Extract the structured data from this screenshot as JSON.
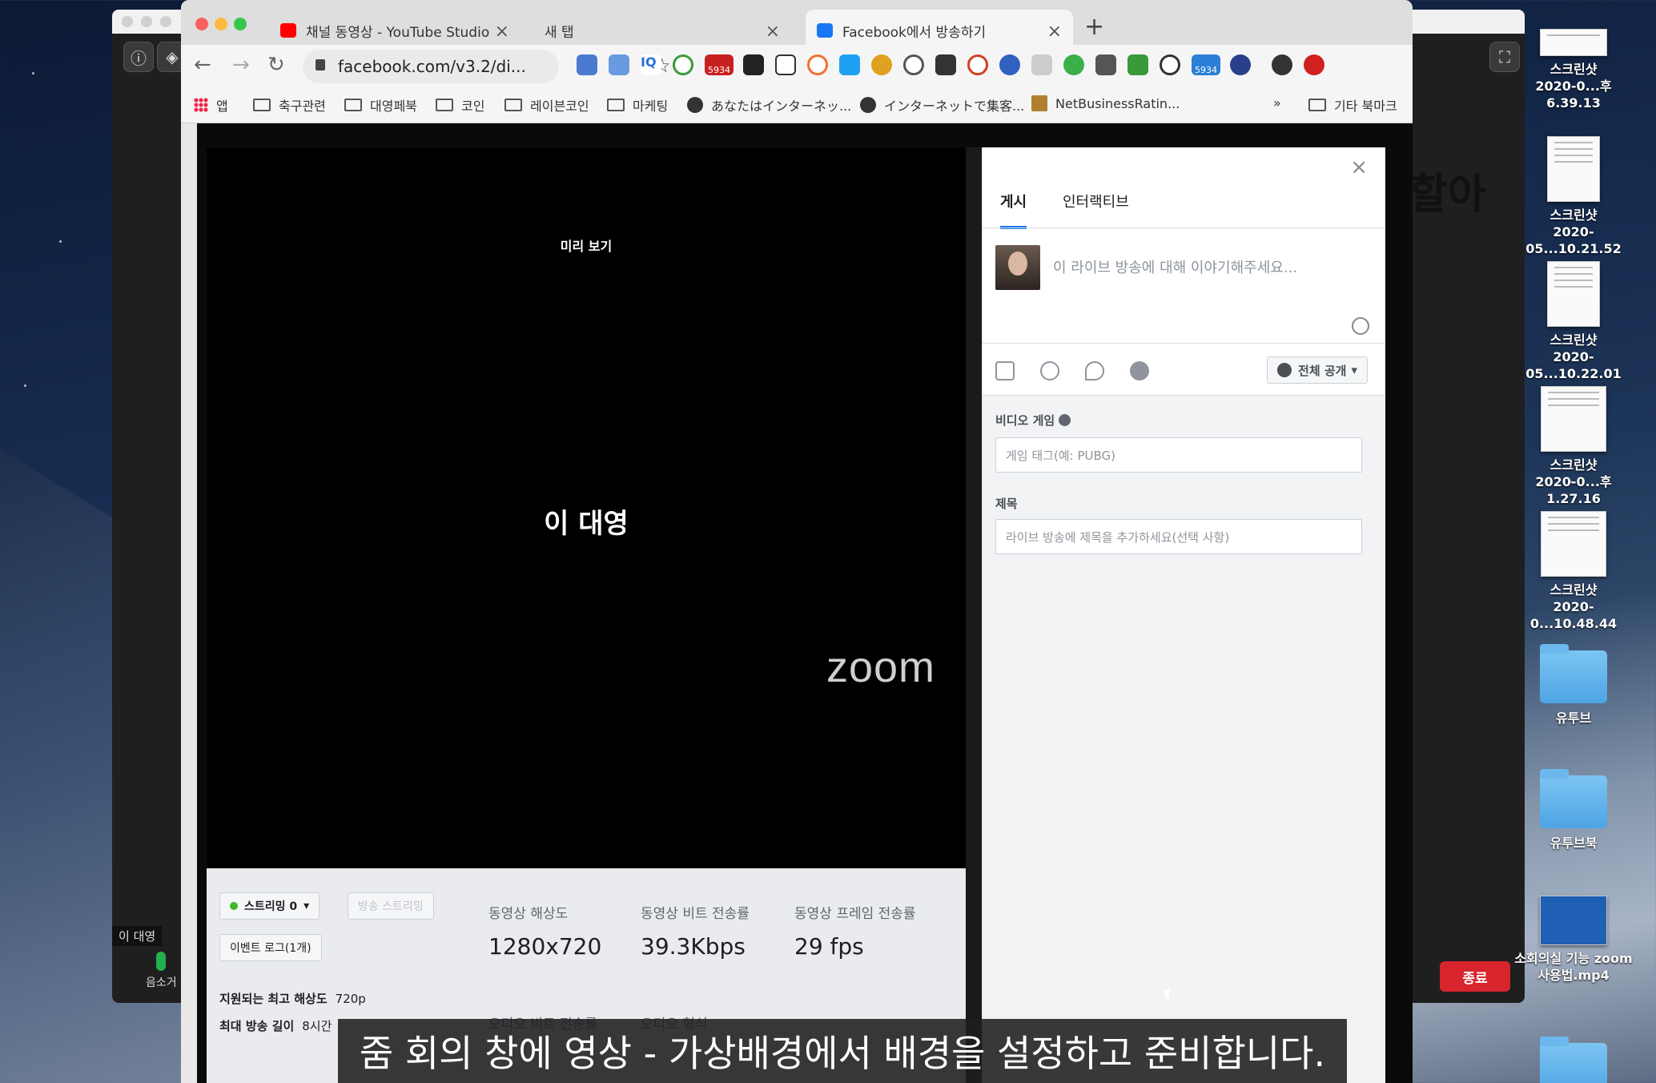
{
  "zoom": {
    "participant_name": "이 대영",
    "mic_label": "음소거",
    "end_label": "종료",
    "big_text": "할아"
  },
  "browser": {
    "tabs": [
      {
        "label": "채널 동영상 - YouTube Studio"
      },
      {
        "label": "새 탭"
      },
      {
        "label": "Facebook에서 방송하기"
      }
    ],
    "url": "facebook.com/v3.2/di...",
    "ext_badge": "5934",
    "bookmarks": [
      "앱",
      "축구관련",
      "대영페북",
      "코인",
      "레이븐코인",
      "마케팅",
      "あなたはインターネッ...",
      "インターネットで集客...",
      "NetBusinessRatin...",
      "»",
      "기타 북마크"
    ]
  },
  "preview": {
    "label": "미리 보기",
    "name": "이 대영",
    "logo": "zoom"
  },
  "stats": {
    "stream_label": "스트리밍 0",
    "stream_btn": "방송 스트리밍",
    "event_log": "이벤트 로그(1개)",
    "items": [
      {
        "label": "동영상 해상도",
        "value": "1280x720"
      },
      {
        "label": "동영상 비트 전송률",
        "value": "39.3Kbps"
      },
      {
        "label": "동영상 프레임 전송률",
        "value": "29 fps"
      }
    ],
    "audio": [
      {
        "label": "오디오 비트 전송률"
      },
      {
        "label": "오디오 형식"
      }
    ],
    "max_res_label": "지원되는 최고 해상도",
    "max_res": "720p",
    "max_len_label": "최대 방송 길이",
    "max_len": "8시간"
  },
  "composer": {
    "tabs": [
      "게시",
      "인터랙티브"
    ],
    "placeholder": "이 라이브 방송에 대해 이야기해주세요...",
    "audience": "전체 공개",
    "game_label": "비디오 게임",
    "game_ph": "게임 태그(예: PUBG)",
    "title_label": "제목",
    "title_ph": "라이브 방송에 제목을 추가하세요(선택 사항)"
  },
  "desktop": [
    {
      "label1": "스크린샷",
      "label2": "2020-0...후 6.39.13"
    },
    {
      "label1": "스크린샷",
      "label2": "2020-05...10.21.52"
    },
    {
      "label1": "스크린샷",
      "label2": "2020-05...10.22.01"
    },
    {
      "label1": "스크린샷",
      "label2": "2020-0...후 1.27.16"
    },
    {
      "label1": "스크린샷",
      "label2": "2020-0...10.48.44"
    },
    {
      "label1": "유투브",
      "label2": ""
    },
    {
      "label1": "유투브북",
      "label2": ""
    },
    {
      "label1": "소회의실 기능 zoom",
      "label2": "사용법.mp4"
    },
    {
      "label1": "",
      "label2": ""
    }
  ],
  "subtitle": "줌 회의 창에 영상 - 가상배경에서 배경을 설정하고 준비합니다."
}
